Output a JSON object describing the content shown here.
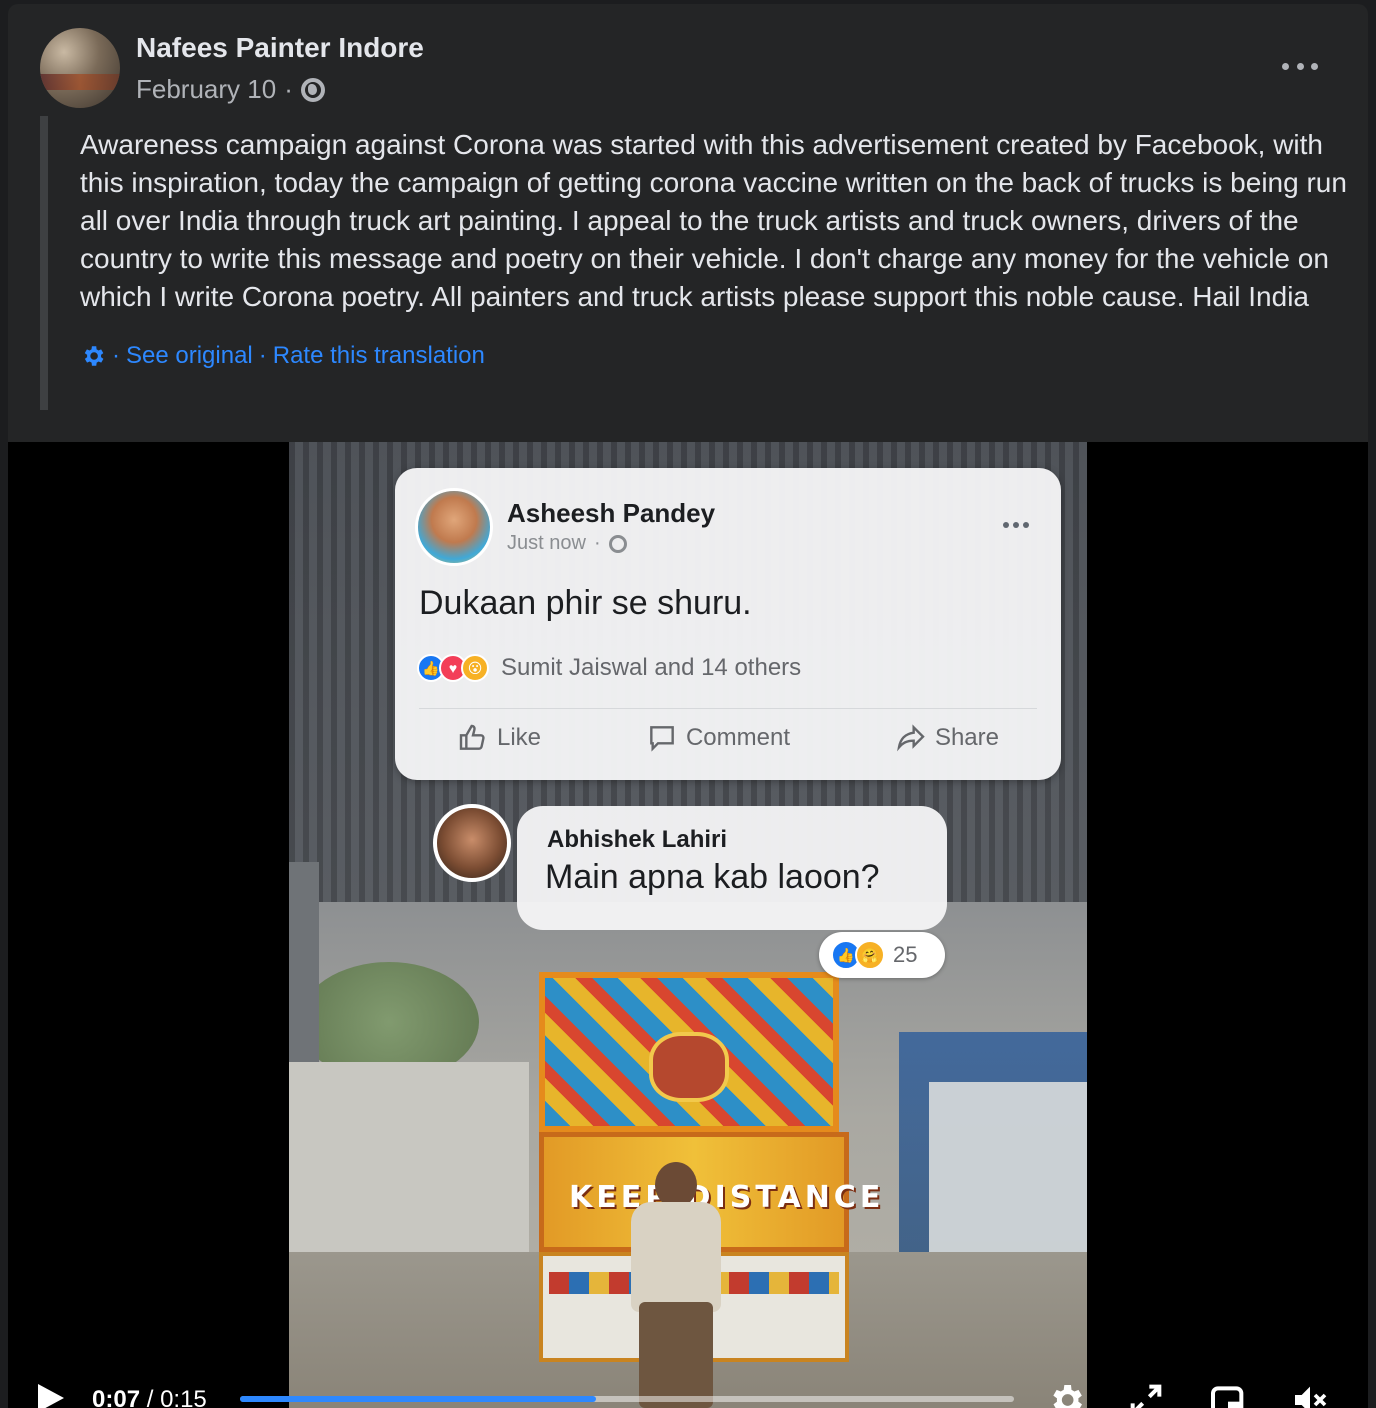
{
  "post": {
    "author": "Nafees Painter Indore",
    "date": "February 10",
    "date_sep": "·",
    "privacy_icon": "globe-icon",
    "more_icon": "more-horizontal-icon",
    "body": "Awareness campaign against Corona was started with this advertisement created by Facebook, with this inspiration, today the campaign of getting corona vaccine written on the back of trucks is being run all over India through truck art painting. I appeal to the truck artists and truck owners, drivers of the country to write this message and poetry on their vehicle. I don't charge any money for the vehicle on which I write Corona poetry. All painters and truck artists please support this noble cause. Hail India",
    "translation": {
      "settings_icon": "gear-icon",
      "sep": "·",
      "see_original": "See original",
      "rate": "Rate this translation"
    }
  },
  "video": {
    "embedded_post": {
      "author": "Asheesh Pandey",
      "time": "Just now",
      "sep": "·",
      "text": "Dukaan phir se shuru.",
      "reactions_text": "Sumit Jaiswal and 14 others",
      "actions": [
        "Like",
        "Comment",
        "Share"
      ]
    },
    "comment": {
      "author": "Abhishek Lahiri",
      "text": "Main apna kab laoon?",
      "reaction_count": "25"
    },
    "truck_text": "KEEP DISTANCE",
    "controls": {
      "current_time": "0:07",
      "separator": "/",
      "duration": "0:15",
      "progress_fraction": 0.46,
      "icons": [
        "play-icon",
        "settings-icon",
        "fullscreen-icon",
        "picture-in-picture-icon",
        "muted-icon"
      ]
    }
  },
  "colors": {
    "card_bg": "#242526",
    "text_primary": "#e4e6eb",
    "text_secondary": "#b0b3b8",
    "link": "#2d88ff",
    "progress": "#2d88ff"
  }
}
